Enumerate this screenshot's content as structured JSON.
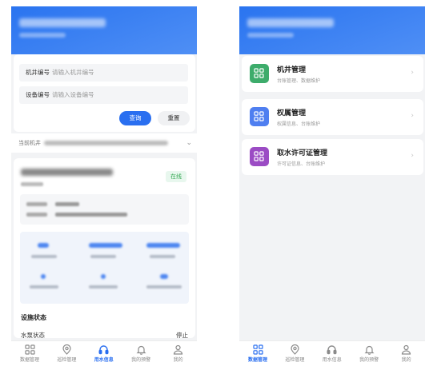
{
  "left": {
    "search": {
      "machine_label": "机井编号",
      "machine_placeholder": "请输入机井编号",
      "device_label": "设备编号",
      "device_placeholder": "请输入设备编号",
      "query_label": "查询",
      "reset_label": "重置"
    },
    "current": {
      "label": "当前机井"
    },
    "detail": {
      "status_badge": "在线",
      "section_title": "设施状态",
      "pump_label": "水泵状态",
      "pump_value": "停止"
    },
    "active_tab": 2
  },
  "right": {
    "menu": [
      {
        "title": "机井管理",
        "desc": "台账管理、数据维护",
        "color": "#3dac6b",
        "icon": "grid-icon"
      },
      {
        "title": "权属管理",
        "desc": "权属信息、台账维护",
        "color": "#4f7ff0",
        "icon": "grid-icon"
      },
      {
        "title": "取水许可证管理",
        "desc": "许可证信息、台账维护",
        "color": "#9b4cc4",
        "icon": "grid-icon"
      }
    ],
    "active_tab": 0
  },
  "tabs": [
    {
      "label": "数据管理",
      "icon": "grid-icon"
    },
    {
      "label": "巡检管理",
      "icon": "location-pin-icon"
    },
    {
      "label": "用水信息",
      "icon": "headset-icon"
    },
    {
      "label": "我的预警",
      "icon": "bell-icon"
    },
    {
      "label": "我的",
      "icon": "user-icon"
    }
  ],
  "colors": {
    "primary": "#2a6ff0",
    "online_green": "#34a853"
  }
}
